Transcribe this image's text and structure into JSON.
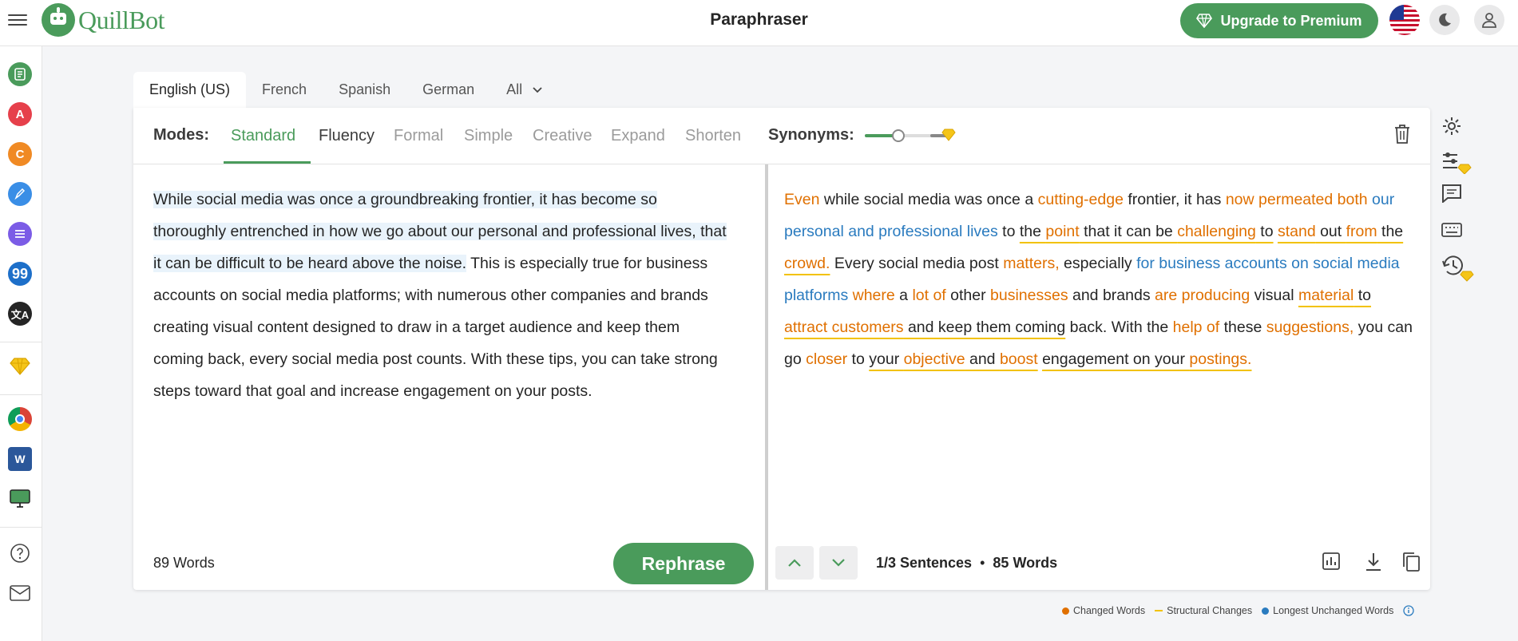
{
  "app": {
    "brand": "QuillBot",
    "title": "Paraphraser",
    "upgrade_label": "Upgrade to Premium"
  },
  "languages": [
    "English (US)",
    "French",
    "Spanish",
    "German",
    "All"
  ],
  "modes": {
    "label": "Modes:",
    "items": [
      "Standard",
      "Fluency",
      "Formal",
      "Simple",
      "Creative",
      "Expand",
      "Shorten"
    ],
    "synonyms_label": "Synonyms:"
  },
  "input": {
    "highlighted_text": "While social media was once a groundbreaking frontier, it has become so thoroughly entrenched in how we go about our personal and professional lives, that it can be difficult to be heard above the noise.",
    "rest_text": " This is especially true for business accounts on social media platforms; with numerous other companies and brands creating visual content designed to draw in a target audience and keep them coming back, every social media post counts. With these tips, you can take strong steps toward that goal and increase engagement on your posts.",
    "word_count": "89 Words",
    "rephrase_label": "Rephrase"
  },
  "output": {
    "segments": [
      {
        "t": "Even",
        "c": "cw"
      },
      {
        "t": " while social media was once a "
      },
      {
        "t": "cutting-edge",
        "c": "cw"
      },
      {
        "t": " frontier, it has "
      },
      {
        "t": "now permeated",
        "c": "cw"
      },
      {
        "t": " "
      },
      {
        "t": "both",
        "c": "cw"
      },
      {
        "t": " "
      },
      {
        "t": "our personal and professional lives",
        "c": "lu"
      },
      {
        "t": " to "
      },
      {
        "t": "the ",
        "c": "sc"
      },
      {
        "t": "point",
        "c": "cw sc"
      },
      {
        "t": " that it can be ",
        "c": "sc"
      },
      {
        "t": "challenging",
        "c": "cw sc"
      },
      {
        "t": " to",
        "c": "sc"
      },
      {
        "t": " "
      },
      {
        "t": "stand",
        "c": "cw sc"
      },
      {
        "t": " out ",
        "c": "sc"
      },
      {
        "t": "from",
        "c": "cw sc"
      },
      {
        "t": " the ",
        "c": "sc"
      },
      {
        "t": "crowd.",
        "c": "cw sc"
      },
      {
        "t": " Every social media post "
      },
      {
        "t": "matters,",
        "c": "cw"
      },
      {
        "t": " especially "
      },
      {
        "t": "for business accounts on social media platforms",
        "c": "lu"
      },
      {
        "t": " "
      },
      {
        "t": "where",
        "c": "cw"
      },
      {
        "t": " a "
      },
      {
        "t": "lot of",
        "c": "cw"
      },
      {
        "t": " other "
      },
      {
        "t": "businesses",
        "c": "cw"
      },
      {
        "t": " and brands "
      },
      {
        "t": "are producing",
        "c": "cw"
      },
      {
        "t": " visual "
      },
      {
        "t": "material",
        "c": "cw sc"
      },
      {
        "t": " to ",
        "c": "sc"
      },
      {
        "t": "attract customers",
        "c": "cw sc"
      },
      {
        "t": " and keep them coming",
        "c": "sc"
      },
      {
        "t": " back. With the "
      },
      {
        "t": "help of",
        "c": "cw"
      },
      {
        "t": " these "
      },
      {
        "t": "suggestions,",
        "c": "cw"
      },
      {
        "t": " you can go "
      },
      {
        "t": "closer",
        "c": "cw"
      },
      {
        "t": " to "
      },
      {
        "t": "your ",
        "c": "sc"
      },
      {
        "t": "objective",
        "c": "cw sc"
      },
      {
        "t": " and ",
        "c": "sc"
      },
      {
        "t": "boost",
        "c": "cw sc"
      },
      {
        "t": " "
      },
      {
        "t": "engagement on your ",
        "c": "sc"
      },
      {
        "t": "postings.",
        "c": "cw sc"
      }
    ],
    "sentences": "1/3 Sentences",
    "bullet": "•",
    "word_count": "85 Words"
  },
  "legend": {
    "changed": "Changed Words",
    "structural": "Structural Changes",
    "unchanged": "Longest Unchanged Words"
  },
  "colors": {
    "accent": "#4a9b5b",
    "changed": "#e07000",
    "structural": "#f2c200",
    "unchanged": "#2a7bbf"
  }
}
